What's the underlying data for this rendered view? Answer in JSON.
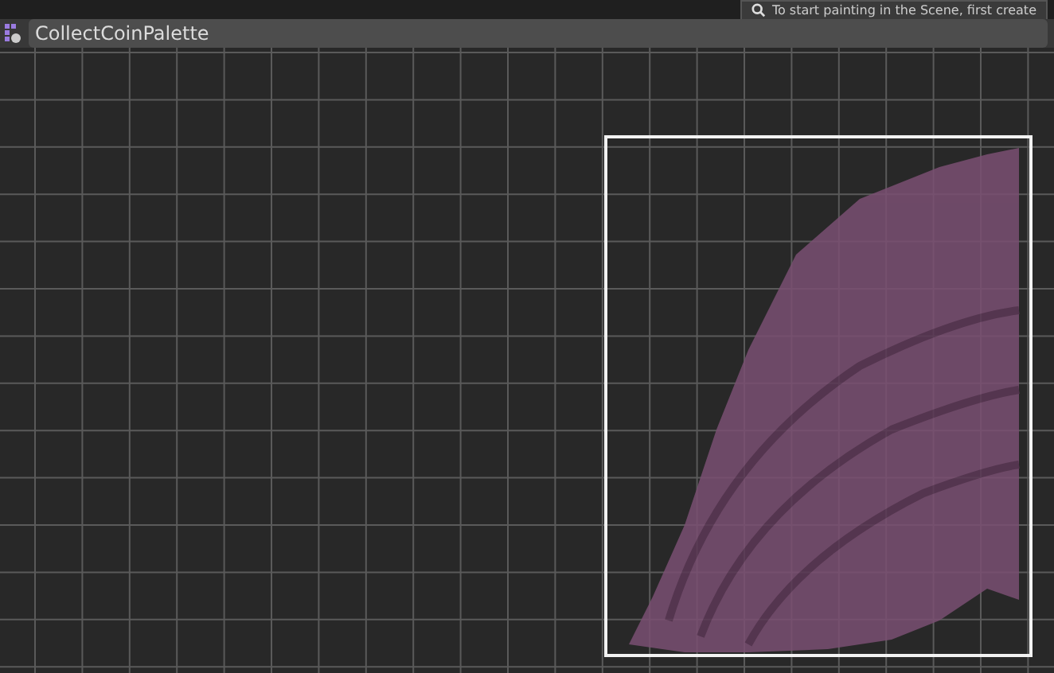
{
  "hint": {
    "text": "To start painting in the Scene, first create"
  },
  "palette": {
    "name": "CollectCoinPalette"
  }
}
